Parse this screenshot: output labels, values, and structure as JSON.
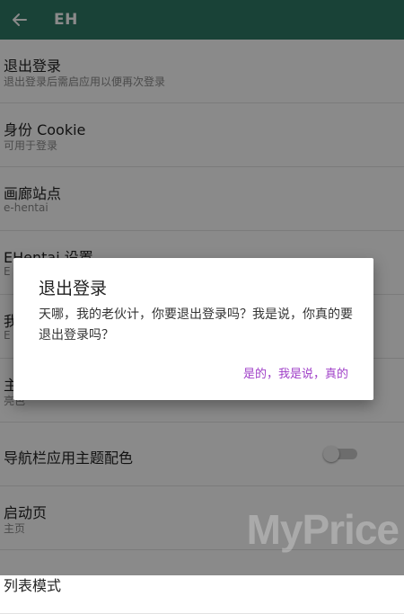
{
  "appbar": {
    "title": "EH",
    "back_icon": "arrow-back-icon"
  },
  "settings": [
    {
      "title": "退出登录",
      "subtitle": "退出登录后需启应用以便再次登录"
    },
    {
      "title": "身份 Cookie",
      "subtitle": "可用于登录"
    },
    {
      "title": "画廊站点",
      "subtitle": "e-hentai"
    },
    {
      "title": "EHentai 设置",
      "subtitle": "E"
    },
    {
      "title": "我",
      "subtitle": "E"
    },
    {
      "title": "主",
      "subtitle": "亮色"
    },
    {
      "title": "导航栏应用主题配色",
      "subtitle": ""
    },
    {
      "title": "启动页",
      "subtitle": "主页"
    },
    {
      "title": "列表模式",
      "subtitle": ""
    }
  ],
  "toggle": {
    "state": "off"
  },
  "dialog": {
    "title": "退出登录",
    "message": "天哪，我的老伙计，你要退出登录吗？我是说，你真的要退出登录吗？",
    "confirm_label": "是的，我是说，真的"
  },
  "watermark": {
    "text": "MyPrice"
  },
  "colors": {
    "appbar": "#2f7a67",
    "accent": "#a040c8"
  }
}
